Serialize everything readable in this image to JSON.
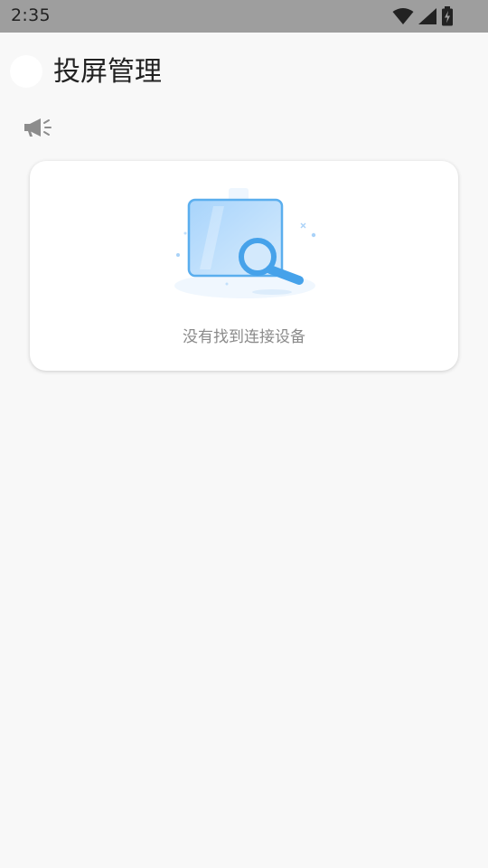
{
  "status_bar": {
    "time": "2:35",
    "icons": [
      "wifi-icon",
      "cellular-signal-icon",
      "battery-charging-icon"
    ]
  },
  "header": {
    "title": "投屏管理",
    "back_icon": "back-circle-icon"
  },
  "announcement": {
    "icon": "megaphone-icon"
  },
  "empty_state": {
    "icon": "search-device-illustration",
    "message": "没有找到连接设备"
  },
  "colors": {
    "status_bar_bg": "#9e9e9e",
    "page_bg": "#f8f8f8",
    "card_bg": "#ffffff",
    "accent_blue": "#4aa8f0",
    "muted_text": "#8a8a8a"
  }
}
